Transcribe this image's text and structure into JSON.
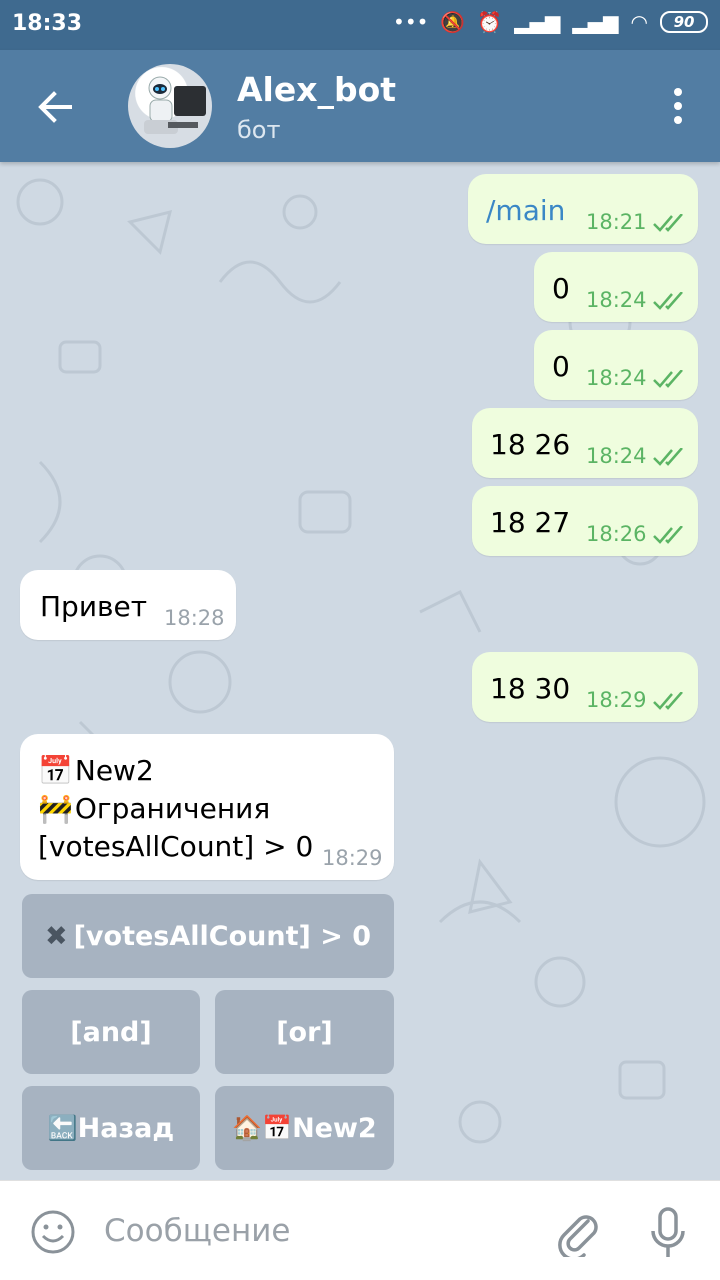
{
  "status": {
    "time": "18:33",
    "battery": "90"
  },
  "header": {
    "title": "Alex_bot",
    "subtitle": "бот"
  },
  "messages": [
    {
      "text": "/main",
      "time": "18:21"
    },
    {
      "text": "0",
      "time": "18:24"
    },
    {
      "text": "0",
      "time": "18:24"
    },
    {
      "text": "18 26",
      "time": "18:24"
    },
    {
      "text": "18 27",
      "time": "18:26"
    },
    {
      "text": "Привет",
      "time": "18:28"
    },
    {
      "text": "18 30",
      "time": "18:29"
    },
    {
      "line1": "New2",
      "line2": "Ограничения",
      "line3": "[votesAllCount] > 0",
      "time": "18:29"
    }
  ],
  "keyboard": {
    "row1": "[votesAllCount] > 0",
    "and": "[and]",
    "or": "[or]",
    "back": "Назад",
    "home": "New2"
  },
  "composer": {
    "placeholder": "Сообщение"
  },
  "colors": {
    "header": "#527da3",
    "outgoing": "#effdde",
    "incoming": "#ffffff",
    "check": "#5bb464"
  }
}
